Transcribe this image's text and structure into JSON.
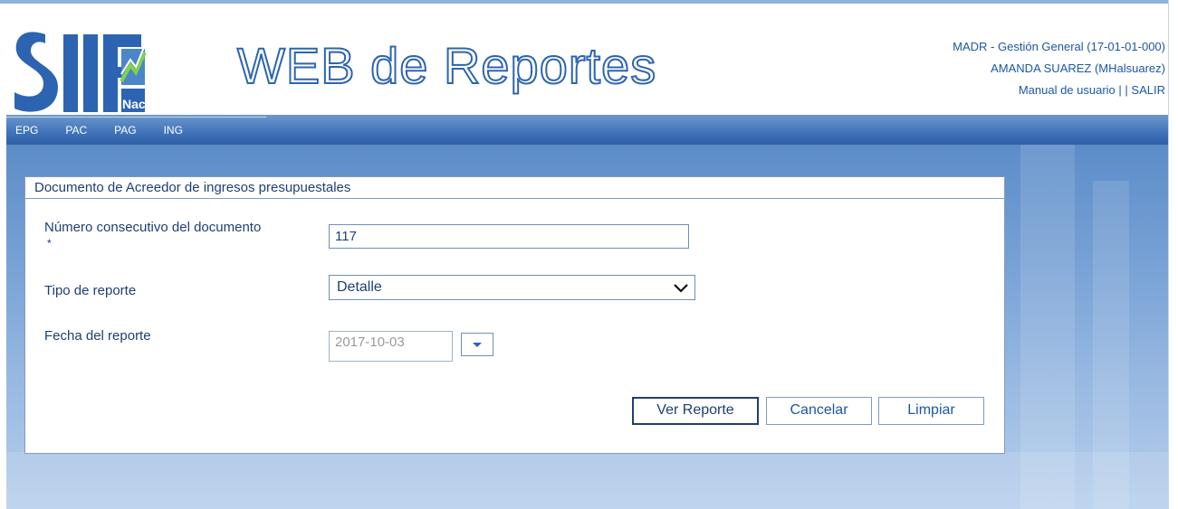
{
  "app": {
    "logo_text": "SIIF Nación",
    "title": "WEB de Reportes"
  },
  "user_box": {
    "entity": "MADR - Gestión General (17-01-01-000)",
    "user": "AMANDA SUAREZ (MHalsuarez)",
    "manual_link": "Manual de usuario",
    "separator": "| |",
    "logout_link": "SALIR"
  },
  "menu": {
    "items": [
      {
        "label": "EPG"
      },
      {
        "label": "PAC"
      },
      {
        "label": "PAG"
      },
      {
        "label": "ING"
      }
    ]
  },
  "form": {
    "title": "Documento de Acreedor de ingresos presupuestales",
    "consecutivo": {
      "label": "Número consecutivo del documento",
      "required_mark": "*",
      "value": "117"
    },
    "tipo": {
      "label": "Tipo de reporte",
      "selected": "Detalle"
    },
    "fecha": {
      "label": "Fecha del reporte",
      "value": "2017-10-03"
    },
    "buttons": {
      "ver": "Ver Reporte",
      "cancelar": "Cancelar",
      "limpiar": "Limpiar"
    }
  },
  "colors": {
    "brand_blue": "#2c64b2",
    "text_dark": "#1d3f74",
    "menu_bar": "#3f73b9"
  },
  "icons": {
    "select_chevron": "chevron-down-icon",
    "date_dropdown": "caret-down-icon"
  }
}
